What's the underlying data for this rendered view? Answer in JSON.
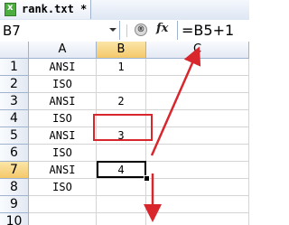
{
  "window": {
    "tab_title": "rank.txt *",
    "file_icon": "excel-file-icon"
  },
  "formula_bar": {
    "name_box": "B7",
    "cancel_icon": "cancel-formula-icon",
    "fx_label": "fx",
    "formula": "=B5+1"
  },
  "columns": [
    "A",
    "B",
    "C"
  ],
  "rows": [
    {
      "num": "1",
      "a": "ANSI",
      "b": "1"
    },
    {
      "num": "2",
      "a": "ISO",
      "b": ""
    },
    {
      "num": "3",
      "a": "ANSI",
      "b": "2"
    },
    {
      "num": "4",
      "a": "ISO",
      "b": ""
    },
    {
      "num": "5",
      "a": "ANSI",
      "b": "3"
    },
    {
      "num": "6",
      "a": "ISO",
      "b": ""
    },
    {
      "num": "7",
      "a": "ANSI",
      "b": "4"
    },
    {
      "num": "8",
      "a": "ISO",
      "b": ""
    },
    {
      "num": "9",
      "a": "",
      "b": ""
    },
    {
      "num": "10",
      "a": "",
      "b": ""
    }
  ],
  "selection": {
    "cell": "B7",
    "row": "7",
    "column": "B"
  },
  "annotation_color": "#d9262c"
}
